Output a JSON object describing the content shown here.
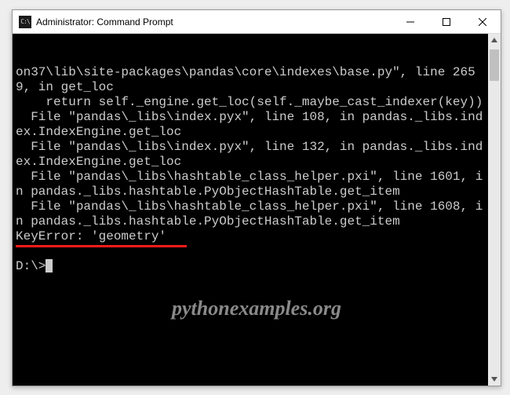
{
  "window": {
    "title": "Administrator: Command Prompt"
  },
  "console": {
    "line1": "on37\\lib\\site-packages\\pandas\\core\\indexes\\base.py\", line 2659, in get_loc",
    "line2": "    return self._engine.get_loc(self._maybe_cast_indexer(key))",
    "line3": "  File \"pandas\\_libs\\index.pyx\", line 108, in pandas._libs.index.IndexEngine.get_loc",
    "line4": "  File \"pandas\\_libs\\index.pyx\", line 132, in pandas._libs.index.IndexEngine.get_loc",
    "line5": "  File \"pandas\\_libs\\hashtable_class_helper.pxi\", line 1601, in pandas._libs.hashtable.PyObjectHashTable.get_item",
    "line6": "  File \"pandas\\_libs\\hashtable_class_helper.pxi\", line 1608, in pandas._libs.hashtable.PyObjectHashTable.get_item",
    "line7": "KeyError: 'geometry'",
    "blank": "",
    "prompt": "D:\\>"
  },
  "watermark": "pythonexamples.org"
}
